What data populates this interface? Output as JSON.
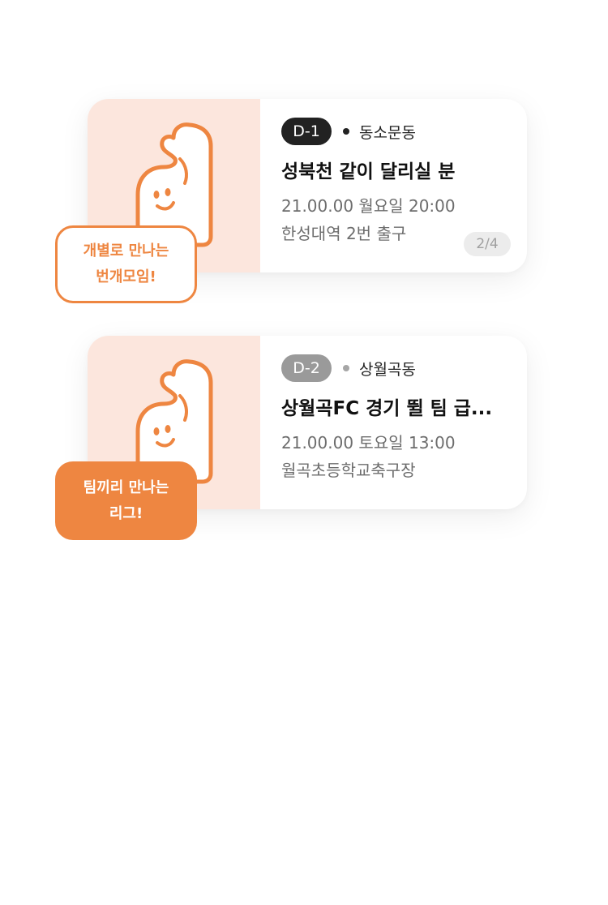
{
  "colors": {
    "accent": "#ee8641",
    "thumb_bg": "#fce6dd",
    "dark_badge": "#222222",
    "gray_badge": "#9a9a9a"
  },
  "cards": [
    {
      "dday": "D-1",
      "location": "동소문동",
      "title": "성북천 같이 달리실 분",
      "datetime": "21.00.00 월요일 20:00",
      "place": "한성대역 2번 출구",
      "count": "2/4",
      "badge_line1": "개별로 만나는",
      "badge_line2": "번개모임!",
      "mascot_icon": "waving-mascot-icon"
    },
    {
      "dday": "D-2",
      "location": "상월곡동",
      "title": "상월곡FC 경기 뛸 팀 급...",
      "datetime": "21.00.00 토요일 13:00",
      "place": "월곡초등학교축구장",
      "badge_line1": "팀끼리 만나는",
      "badge_line2": "리그!",
      "mascot_icon": "waving-mascot-icon"
    }
  ]
}
